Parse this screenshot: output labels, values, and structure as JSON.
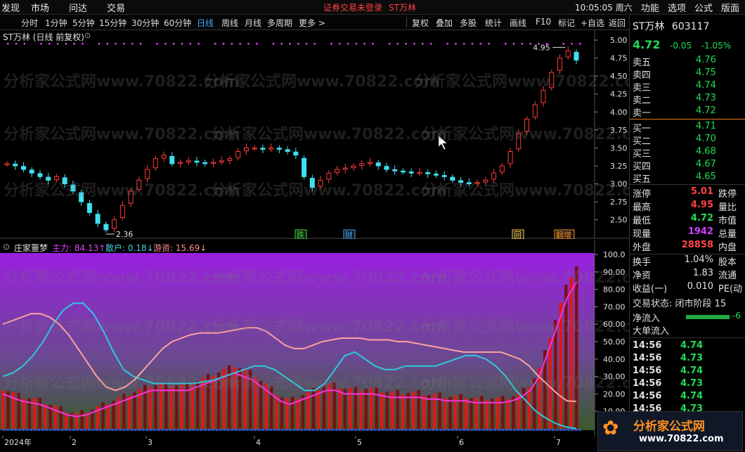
{
  "menu": {
    "items": [
      "发现",
      "市场",
      "问达",
      "交易"
    ],
    "notice": "证券交易未登录",
    "stock_short": "ST万林",
    "clock": "10:05:05 周六",
    "right_items": [
      "功能",
      "选项",
      "公式",
      "版面"
    ]
  },
  "toolbar": {
    "periods": [
      "分时",
      "1分钟",
      "5分钟",
      "15分钟",
      "30分钟",
      "60分钟",
      "日线",
      "周线",
      "月线",
      "多周期",
      "更多 >"
    ],
    "active": "日线",
    "right": [
      "复权",
      "叠加",
      "多股",
      "统计",
      "画线",
      "F10",
      "标记",
      "+自选",
      "返回"
    ]
  },
  "chart_title": "ST万林 (日线 前复权)",
  "price_axis": {
    "ticks": [
      "5.00",
      "4.75",
      "4.50",
      "4.25",
      "4.00",
      "3.75",
      "3.50",
      "3.25",
      "3.00",
      "2.75",
      "2.50"
    ]
  },
  "annotations": {
    "high": "4.95",
    "low": "2.36"
  },
  "event_tags": [
    "跌",
    "财",
    "回",
    "翻增"
  ],
  "indicator": {
    "name": "庄家噩梦",
    "zhuli": "主力: 84.13↑",
    "sanhu": "散户: 0.18↓",
    "youzi": "游资: 15.69↓"
  },
  "ind_axis": {
    "ticks": [
      "100.0",
      "90.00",
      "80.00",
      "70.00",
      "60.00",
      "50.00",
      "40.00",
      "30.00",
      "20.00",
      "10.00"
    ]
  },
  "time_axis": {
    "labels": [
      "2024年",
      "2",
      "3",
      "4",
      "5",
      "6",
      "7"
    ]
  },
  "quote": {
    "name": "ST万林",
    "code": "603117",
    "price": "4.72",
    "change": "-0.05",
    "pct": "-1.05%",
    "asks": [
      {
        "label": "卖五",
        "price": "4.76"
      },
      {
        "label": "卖四",
        "price": "4.75"
      },
      {
        "label": "卖三",
        "price": "4.74"
      },
      {
        "label": "卖二",
        "price": "4.73"
      },
      {
        "label": "卖一",
        "price": "4.72"
      }
    ],
    "bids": [
      {
        "label": "买一",
        "price": "4.71"
      },
      {
        "label": "买二",
        "price": "4.70"
      },
      {
        "label": "买三",
        "price": "4.68"
      },
      {
        "label": "买四",
        "price": "4.67"
      },
      {
        "label": "买五",
        "price": "4.65"
      }
    ],
    "stats": [
      {
        "l": "涨停",
        "v": "5.01",
        "r": "跌停",
        "c": "#ff4444"
      },
      {
        "l": "最高",
        "v": "4.95",
        "r": "量比",
        "c": "#ff4444"
      },
      {
        "l": "最低",
        "v": "4.72",
        "r": "市值",
        "c": "#22dd55"
      },
      {
        "l": "现量",
        "v": "1942",
        "r": "总量",
        "c": "#d040ff"
      },
      {
        "l": "外盘",
        "v": "28858",
        "r": "内盘",
        "c": "#ff4444"
      }
    ],
    "fin": [
      {
        "l": "换手",
        "v": "1.04%",
        "r": "股本"
      },
      {
        "l": "净资",
        "v": "1.83",
        "r": "流通"
      },
      {
        "l": "收益(一)",
        "v": "0.010",
        "r": "PE(动"
      }
    ],
    "status": "交易状态: 闭市阶段 15",
    "flow": [
      {
        "l": "净流入",
        "v": "-6"
      },
      {
        "l": "大单流入",
        "v": ""
      }
    ],
    "ticks": [
      {
        "t": "14:56",
        "p": "4.74"
      },
      {
        "t": "14:56",
        "p": "4.73"
      },
      {
        "t": "14:56",
        "p": "4.74"
      },
      {
        "t": "14:56",
        "p": "4.73"
      },
      {
        "t": "14:56",
        "p": "4.74"
      },
      {
        "t": "14:56",
        "p": "4.73"
      }
    ]
  },
  "watermark": "分析家公式网www.70822.com",
  "logo": {
    "cn": "分析家公式网",
    "url": "www.70822.com"
  },
  "chart_data": {
    "type": "candlestick",
    "title": "ST万林 (日线 前复权)",
    "ylim": [
      2.35,
      5.0
    ],
    "x_labels": [
      "2024年",
      "2",
      "3",
      "4",
      "5",
      "6",
      "7"
    ],
    "close_path": [
      3.28,
      3.25,
      3.2,
      3.15,
      3.1,
      3.05,
      3.1,
      3.0,
      2.9,
      2.75,
      2.6,
      2.45,
      2.36,
      2.5,
      2.7,
      2.9,
      3.05,
      3.2,
      3.35,
      3.4,
      3.28,
      3.3,
      3.32,
      3.3,
      3.28,
      3.3,
      3.32,
      3.35,
      3.45,
      3.5,
      3.5,
      3.48,
      3.5,
      3.48,
      3.45,
      3.4,
      3.1,
      2.95,
      3.05,
      3.15,
      3.2,
      3.22,
      3.25,
      3.28,
      3.3,
      3.25,
      3.2,
      3.18,
      3.17,
      3.15,
      3.16,
      3.14,
      3.12,
      3.1,
      3.05,
      3.02,
      3.0,
      3.02,
      3.05,
      3.15,
      3.25,
      3.45,
      3.7,
      3.9,
      4.1,
      4.3,
      4.55,
      4.75,
      4.85,
      4.72
    ],
    "indicator": {
      "name": "庄家噩梦",
      "ylim": [
        0,
        100
      ],
      "series": [
        {
          "name": "主力",
          "final": 84.13,
          "values": [
            20,
            18,
            16,
            15,
            14,
            12,
            10,
            8,
            7,
            8,
            10,
            12,
            14,
            16,
            18,
            20,
            22,
            22,
            22,
            22,
            22,
            24,
            26,
            28,
            30,
            32,
            30,
            28,
            24,
            20,
            16,
            14,
            16,
            18,
            20,
            22,
            22,
            20,
            20,
            20,
            20,
            19,
            18,
            18,
            18,
            18,
            17,
            17,
            16,
            16,
            16,
            15,
            15,
            15,
            15,
            16,
            18,
            22,
            30,
            45,
            60,
            75,
            84
          ]
        },
        {
          "name": "散户",
          "final": 0.18,
          "values": [
            30,
            32,
            36,
            42,
            50,
            60,
            68,
            72,
            72,
            66,
            56,
            44,
            34,
            30,
            28,
            26,
            26,
            26,
            26,
            26,
            27,
            28,
            30,
            32,
            34,
            36,
            36,
            34,
            30,
            26,
            22,
            22,
            26,
            34,
            42,
            44,
            40,
            36,
            34,
            34,
            36,
            36,
            36,
            36,
            38,
            40,
            42,
            42,
            40,
            36,
            30,
            22,
            16,
            10,
            6,
            3,
            1,
            0.18
          ]
        },
        {
          "name": "游资",
          "final": 15.69,
          "values": [
            60,
            62,
            64,
            66,
            66,
            64,
            60,
            54,
            46,
            38,
            30,
            24,
            22,
            24,
            28,
            34,
            40,
            46,
            50,
            52,
            54,
            55,
            55,
            55,
            56,
            57,
            58,
            58,
            56,
            52,
            48,
            46,
            46,
            48,
            50,
            51,
            52,
            52,
            52,
            51,
            51,
            51,
            50,
            50,
            49,
            48,
            47,
            46,
            45,
            44,
            44,
            44,
            44,
            44,
            42,
            40,
            36,
            30,
            25,
            20,
            16,
            15.69
          ]
        }
      ]
    }
  }
}
